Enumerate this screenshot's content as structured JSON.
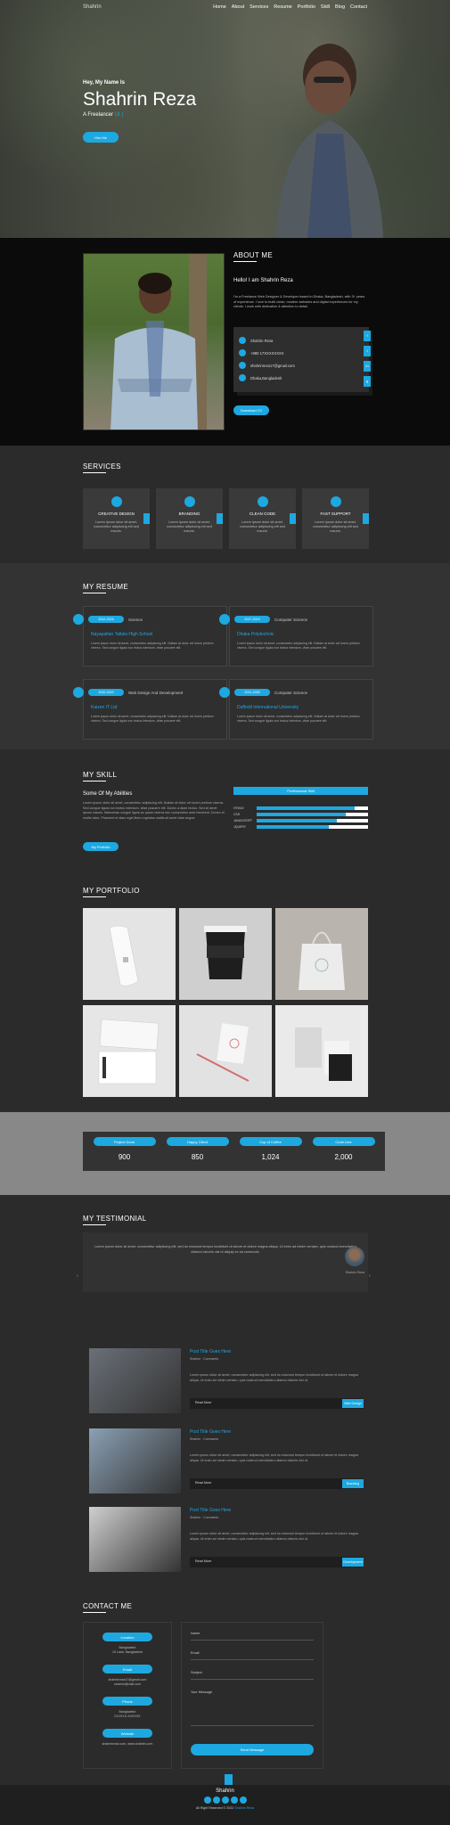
{
  "nav": {
    "logo": "Shahrin",
    "items": [
      "Home",
      "About",
      "Services",
      "Resume",
      "Portfolio",
      "Skill",
      "Blog",
      "Contact"
    ]
  },
  "hero": {
    "greeting": "Hey, My Name Is",
    "name": "Shahrin Reza",
    "role_prefix": "A Freelancer",
    "role_highlight": "UI |",
    "cta": "Hire Me"
  },
  "about": {
    "title": "ABOUT ME",
    "hello": "Hello! I am Shahrin Reza",
    "para": "I'm a Freelance Web Designer & Developer based in Dhaka, Bangladesh, with 3+ years of experience. I love to build clean, modern websites and digital experiences for my clients. I work with dedication & attention to detail.",
    "contacts": [
      {
        "icon": "user-icon",
        "value": "Shahrin Reza"
      },
      {
        "icon": "phone-icon",
        "value": "+880 17XXXXXXXX"
      },
      {
        "icon": "email-icon",
        "value": "shahrinreza17@gmail.com"
      },
      {
        "icon": "location-icon",
        "value": "Dhaka,Bangladesh"
      }
    ],
    "download": "Download CV"
  },
  "services": {
    "title": "SERVICES",
    "items": [
      {
        "icon": "design-icon",
        "title": "CREATIVE DESIGN",
        "desc": "Lorem ipsum dolor sit amet, consectetur adipiscing elit sed mauris."
      },
      {
        "icon": "brand-icon",
        "title": "BRANDING",
        "desc": "Lorem ipsum dolor sit amet, consectetur adipiscing elit sed mauris."
      },
      {
        "icon": "code-icon",
        "title": "CLEAN CODE",
        "desc": "Lorem ipsum dolor sit amet, consectetur adipiscing elit sed mauris."
      },
      {
        "icon": "support-icon",
        "title": "FAST SUPPORT",
        "desc": "Lorem ipsum dolor sit amet, consectetur adipiscing elit sed mauris."
      }
    ]
  },
  "resume": {
    "title": "MY RESUME",
    "items": [
      {
        "years": "2012-2016",
        "subject": "Science",
        "heading": "Nayapaltan Taltala High School",
        "desc": "Lorem ipsum dolor sit amet, consectetur adipiscing elit. Nullam at dolor vel lorem pretium viverra. Sed congue ligula non lectus interdum, vitae posuere elit."
      },
      {
        "years": "2017-2019",
        "subject": "Computer Science",
        "heading": "Dhaka Polytechnic",
        "desc": "Lorem ipsum dolor sit amet, consectetur adipiscing elit. Nullam at dolor vel lorem pretium viverra. Sed congue ligula non lectus interdum, vitae posuere elit."
      },
      {
        "years": "2020-2022",
        "subject": "Web Design And Development",
        "heading": "Kaizen IT Ltd",
        "desc": "Lorem ipsum dolor sit amet, consectetur adipiscing elit. Nullam at dolor vel lorem pretium viverra. Sed congue ligula non lectus interdum, vitae posuere elit."
      },
      {
        "years": "2021-2025",
        "subject": "Computer Science",
        "heading": "Daffodil International University",
        "desc": "Lorem ipsum dolor sit amet, consectetur adipiscing elit. Nullam at dolor vel lorem pretium viverra. Sed congue ligula non lectus interdum, vitae posuere elit."
      }
    ]
  },
  "skill": {
    "title": "MY SKILL",
    "heading": "Some Of My Abilities",
    "para": "Lorem ipsum dolor sit amet, consectetur adipiscing elit. Nullam at dolor vel lorem pretium viverra. Sed congue ligula non lectus interdum, vitae posuere elit. Donec a diam lectus. Sed sit amet ipsum mauris. Maecenas congue ligula ac quam viverra nec consectetur ante hendrerit. Donec et mollis dolor. Praesent et diam eget libero egestas mattis sit amet vitae augue.",
    "portfolio_btn": "My Portfolio",
    "bar_label": "Professional Skill",
    "bars": [
      {
        "label": "HTML5",
        "value": 0.88
      },
      {
        "label": "CSS",
        "value": 0.8
      },
      {
        "label": "JAVASCRIPT",
        "value": 0.72
      },
      {
        "label": "JQUERY",
        "value": 0.65
      }
    ]
  },
  "portfolio": {
    "title": "MY PORTFOLIO"
  },
  "counters": [
    {
      "icon": "project-icon",
      "label": "Project Done",
      "value": "900"
    },
    {
      "icon": "client-icon",
      "label": "Happy Client",
      "value": "850"
    },
    {
      "icon": "coffee-icon",
      "label": "Cup of Coffee",
      "value": "1,024"
    },
    {
      "icon": "code-icon",
      "label": "Code Line",
      "value": "2,000"
    }
  ],
  "testimonial": {
    "title": "MY TESTIMONIAL",
    "quote": "Lorem ipsum dolor sit amet, consectetur adipiscing elit, sed do eiusmod tempor incididunt ut labore et dolore magna aliqua. Ut enim ad minim veniam, quis nostrud exercitation ullamco laboris nisi ut aliquip ex ea commodo.",
    "name": "Shahrin Reza"
  },
  "blog": {
    "posts": [
      {
        "title": "Post Title Goes Here",
        "meta": "Shahrin  ·  Comments",
        "excerpt": "Lorem ipsum dolor sit amet, consectetur adipiscing elit, sed do eiusmod tempor incididunt ut labore et dolore magna aliqua. Ut enim ad minim veniam, quis nostrud exercitation ullamco laboris nisi ut.",
        "read": "Read More",
        "tag": "Web Design"
      },
      {
        "title": "Post Title Goes Here",
        "meta": "Shahrin  ·  Comments",
        "excerpt": "Lorem ipsum dolor sit amet, consectetur adipiscing elit, sed do eiusmod tempor incididunt ut labore et dolore magna aliqua. Ut enim ad minim veniam, quis nostrud exercitation ullamco laboris nisi ut.",
        "read": "Read More",
        "tag": "Branding"
      },
      {
        "title": "Post Title Goes Here",
        "meta": "Shahrin  ·  Comments",
        "excerpt": "Lorem ipsum dolor sit amet, consectetur adipiscing elit, sed do eiusmod tempor incididunt ut labore et dolore magna aliqua. Ut enim ad minim veniam, quis nostrud exercitation ullamco laboris nisi ut.",
        "read": "Read More",
        "tag": "Development"
      }
    ]
  },
  "contact": {
    "title": "CONTACT ME",
    "info": [
      {
        "label": "Location",
        "value": "Bangladesh\n10 Lane, Bangladesh"
      },
      {
        "label": "Email",
        "value": "shahrinreza17@gmail.com\nshahrin@mail.com"
      },
      {
        "label": "Phone",
        "value": "Bangladesh\n01XXXX-XXXXXX"
      },
      {
        "label": "Website",
        "value": "shahrinreza.com, www.shahrin.com"
      }
    ],
    "fields": [
      "Name",
      "Email",
      "Subject",
      "Your Message"
    ],
    "send": "Send Message"
  },
  "footer": {
    "brand": "Shahrin",
    "copy": "All Right Reserved © 2022",
    "copy_by": "Shahrin Reza"
  },
  "colors": {
    "accent": "#1ea8e0",
    "dark": "#2b2b2b"
  }
}
